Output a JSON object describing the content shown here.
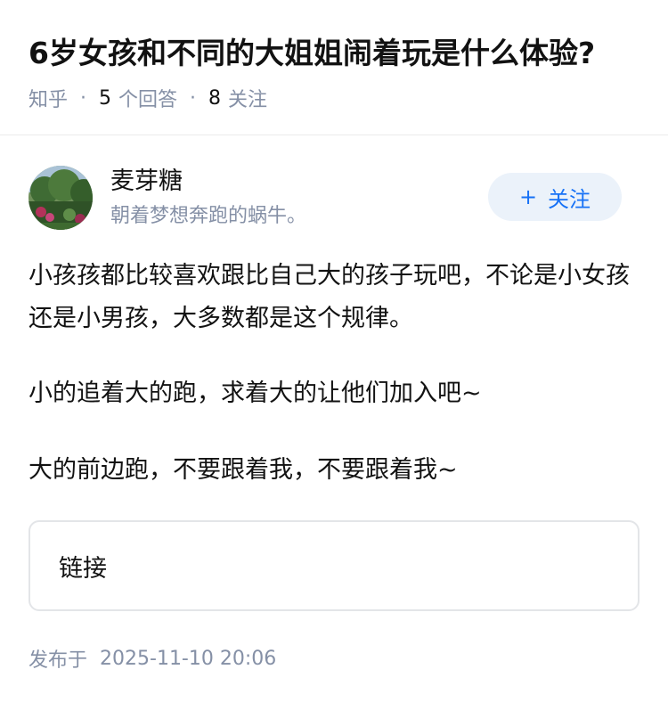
{
  "question": {
    "title": "6岁女孩和不同的大姐姐闹着玩是什么体验?",
    "source": "知乎",
    "answer_count": "5",
    "answer_label": "个回答",
    "follow_count": "8",
    "follow_label": "关注"
  },
  "author": {
    "name": "麦芽糖",
    "bio": "朝着梦想奔跑的蜗牛。",
    "avatar_icon": "avatar-photo-icon",
    "follow_button": {
      "plus": "+",
      "label": "关注"
    }
  },
  "answer": {
    "paragraphs": [
      "小孩孩都比较喜欢跟比自己大的孩子玩吧，不论是小女孩还是小男孩，大多数都是这个规律。",
      "小的追着大的跑，求着大的让他们加入吧~",
      "大的前边跑，不要跟着我，不要跟着我~"
    ],
    "link_card_label": "链接",
    "publish_label": "发布于",
    "publish_time": "2025-11-10 20:06"
  },
  "colors": {
    "accent": "#1772f6",
    "follow_bg": "#ebf2fa",
    "muted_text": "#8590a6",
    "primary_text": "#121212"
  }
}
